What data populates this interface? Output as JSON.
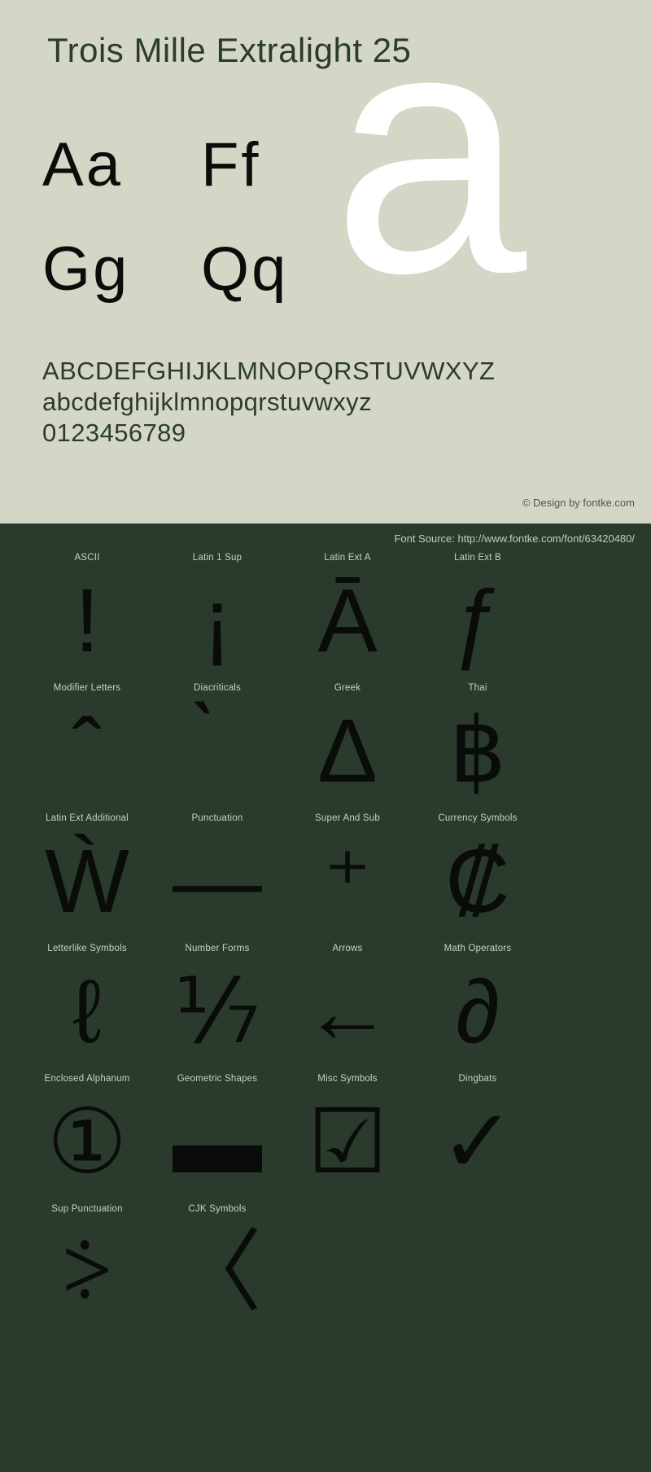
{
  "header": {
    "title": "Trois Mille Extralight 25"
  },
  "specimen": {
    "watermark_glyph": "a",
    "letter_pairs": [
      [
        "Aa",
        "Ff"
      ],
      [
        "Gg",
        "Qq"
      ]
    ],
    "alphabet_lines": [
      "ABCDEFGHIJKLMNOPQRSTUVWXYZ",
      "abcdefghijklmnopqrstuvwxyz",
      "0123456789"
    ],
    "credit": "© Design by fontke.com"
  },
  "source": {
    "label": "Font Source: http://www.fontke.com/font/63420480/"
  },
  "unicode_blocks": {
    "rows": [
      [
        {
          "label": "ASCII",
          "glyph": "!"
        },
        {
          "label": "Latin 1 Sup",
          "glyph": "¡"
        },
        {
          "label": "Latin Ext A",
          "glyph": "Ā"
        },
        {
          "label": "Latin Ext B",
          "glyph": "ƒ"
        }
      ],
      [
        {
          "label": "Modifier Letters",
          "glyph": "ˆ"
        },
        {
          "label": "Diacriticals",
          "glyph": "̀"
        },
        {
          "label": "Greek",
          "glyph": "Δ"
        },
        {
          "label": "Thai",
          "glyph": "฿"
        }
      ],
      [
        {
          "label": "Latin Ext Additional",
          "glyph": "Ẁ"
        },
        {
          "label": "Punctuation",
          "glyph": "—"
        },
        {
          "label": "Super And Sub",
          "glyph": "⁺"
        },
        {
          "label": "Currency Symbols",
          "glyph": "₡"
        }
      ],
      [
        {
          "label": "Letterlike Symbols",
          "glyph": "ℓ"
        },
        {
          "label": "Number Forms",
          "glyph": "⅐"
        },
        {
          "label": "Arrows",
          "glyph": "←"
        },
        {
          "label": "Math Operators",
          "glyph": "∂"
        }
      ],
      [
        {
          "label": "Enclosed Alphanum",
          "glyph": "①"
        },
        {
          "label": "Geometric Shapes",
          "glyph": "▬"
        },
        {
          "label": "Misc Symbols",
          "glyph": "☑"
        },
        {
          "label": "Dingbats",
          "glyph": "✓"
        }
      ],
      [
        {
          "label": "Sup Punctuation",
          "glyph": "⸖"
        },
        {
          "label": "CJK Symbols",
          "glyph": "〈"
        },
        {
          "label": "",
          "glyph": ""
        },
        {
          "label": "",
          "glyph": ""
        }
      ]
    ]
  },
  "colors": {
    "sage_background": "#d4d7c6",
    "dark_background": "#2a3b2d",
    "title_text": "#2b3c2f",
    "glyph_black": "#0a0c09",
    "watermark_white": "#ffffff",
    "label_text": "#c9d0c4"
  }
}
